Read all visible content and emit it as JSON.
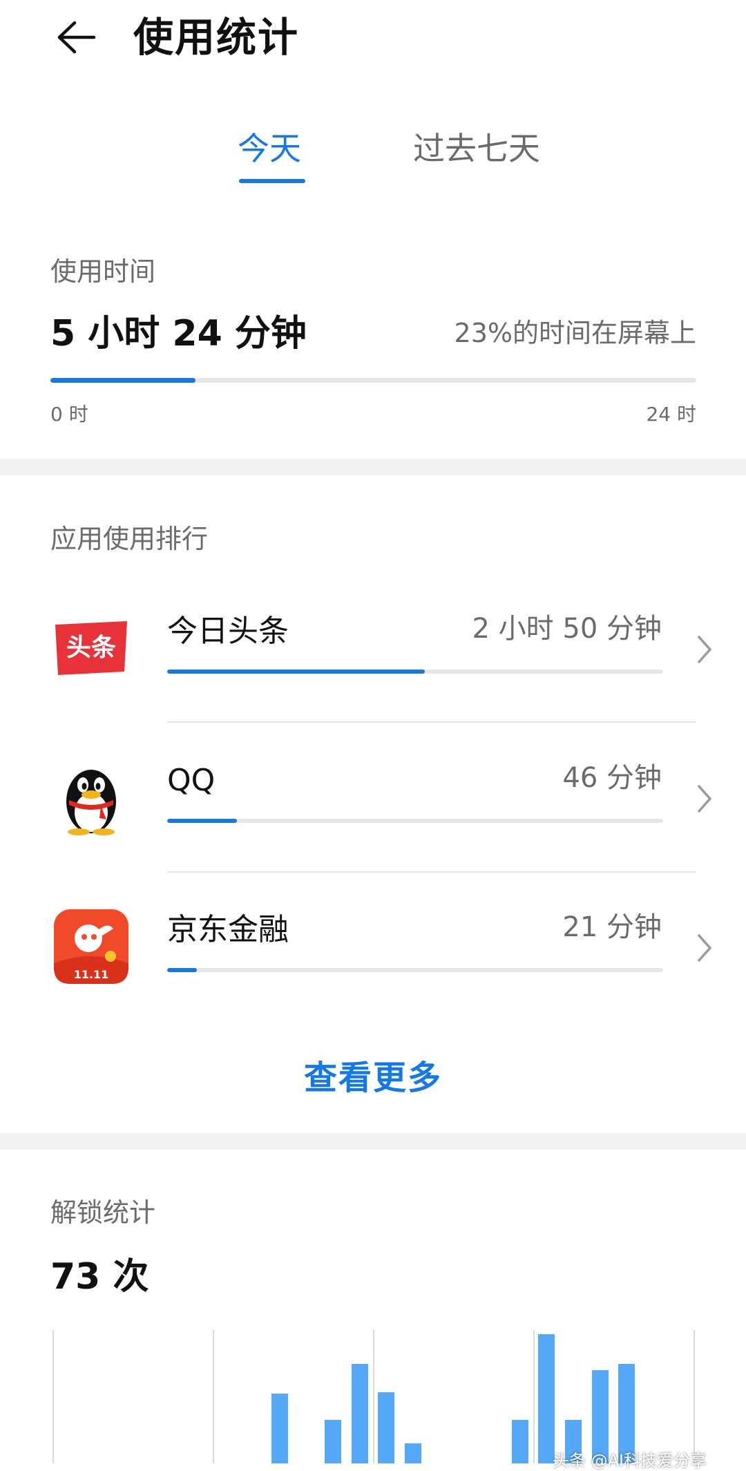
{
  "header": {
    "title": "使用统计"
  },
  "tabs": [
    {
      "label": "今天",
      "active": true
    },
    {
      "label": "过去七天",
      "active": false
    }
  ],
  "usage_time": {
    "label": "使用时间",
    "value": "5 小时 24 分钟",
    "percent_text": "23%的时间在屏幕上",
    "progress_fraction": 0.225,
    "axis_start": "0 时",
    "axis_end": "24 时"
  },
  "app_ranking": {
    "label": "应用使用排行",
    "apps": [
      {
        "name": "今日头条",
        "time": "2 小时 50 分钟",
        "fraction": 0.52,
        "icon": "toutiao-icon",
        "icon_text": "头条"
      },
      {
        "name": "QQ",
        "time": "46 分钟",
        "fraction": 0.14,
        "icon": "qq-penguin-icon"
      },
      {
        "name": "京东金融",
        "time": "21 分钟",
        "fraction": 0.06,
        "icon": "jd-finance-icon",
        "icon_text": "11.11"
      }
    ],
    "more_label": "查看更多"
  },
  "unlock_stats": {
    "label": "解锁统计",
    "value": "73 次"
  },
  "chart_data": {
    "type": "bar",
    "title": "",
    "series": [
      {
        "values": [
          0,
          0,
          0,
          0,
          0,
          0,
          0,
          0,
          3.5,
          0,
          2.2,
          5.0,
          3.6,
          1.0,
          0,
          0,
          0,
          2.2,
          6.5,
          2.2,
          4.7,
          5.0,
          0,
          0
        ]
      }
    ],
    "x_range": [
      0,
      24
    ],
    "grid": "vertical lines every 6 hours",
    "colors": {
      "bar": "#55a7f7"
    }
  },
  "watermark": "头条 @AI科技爱分享",
  "colors": {
    "accent": "#1479e6",
    "secondary_text": "#6b6b6b",
    "track": "#e6e6e6",
    "band": "#f2f2f2"
  }
}
